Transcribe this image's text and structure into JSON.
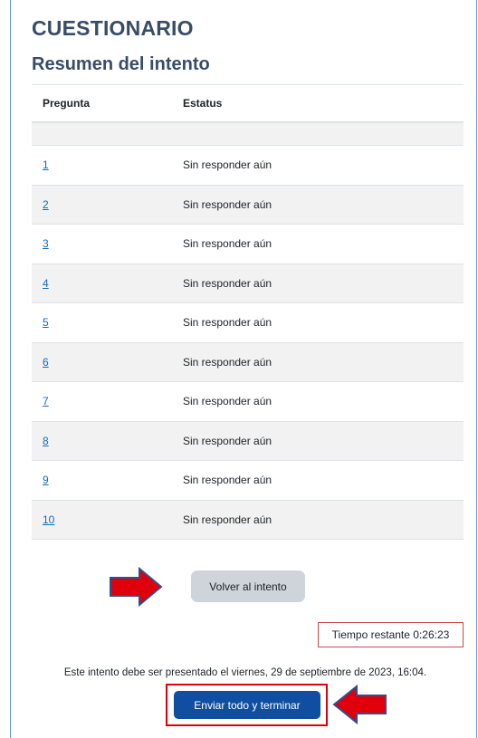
{
  "quiz": {
    "title": "CUESTIONARIO",
    "subtitle": "Resumen del intento"
  },
  "table": {
    "headers": {
      "question": "Pregunta",
      "status": "Estatus"
    },
    "rows": [
      {
        "number": "1",
        "status": "Sin responder aún"
      },
      {
        "number": "2",
        "status": "Sin responder aún"
      },
      {
        "number": "3",
        "status": "Sin responder aún"
      },
      {
        "number": "4",
        "status": "Sin responder aún"
      },
      {
        "number": "5",
        "status": "Sin responder aún"
      },
      {
        "number": "6",
        "status": "Sin responder aún"
      },
      {
        "number": "7",
        "status": "Sin responder aún"
      },
      {
        "number": "8",
        "status": "Sin responder aún"
      },
      {
        "number": "9",
        "status": "Sin responder aún"
      },
      {
        "number": "10",
        "status": "Sin responder aún"
      }
    ]
  },
  "actions": {
    "back_label": "Volver al intento",
    "submit_label": "Enviar todo y terminar"
  },
  "timer": {
    "label": "Tiempo restante",
    "value": "0:26:23"
  },
  "deadline_text": "Este intento debe ser presentado el viernes, 29 de septiembre de 2023, 16:04.",
  "icons": {
    "pointer_arrows": "arrow-icon"
  },
  "colors": {
    "heading": "#374d67",
    "link": "#0f6cbf",
    "primary_button": "#0f4ea0",
    "secondary_button": "#ced4da",
    "highlight": "#e0000b"
  }
}
